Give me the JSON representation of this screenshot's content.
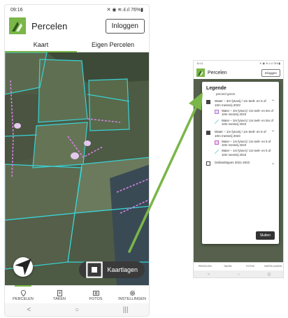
{
  "status_bar": {
    "time": "09:16",
    "icons": "✕ ◉ ≋.ıl.ıl 76%▮"
  },
  "app": {
    "title": "Percelen",
    "login": "Inloggen"
  },
  "tabs": [
    {
      "label": "Kaart"
    },
    {
      "label": "Eigen Percelen"
    }
  ],
  "map_controls": {
    "layers_label": "Kaartlagen"
  },
  "bottom_nav": [
    {
      "label": "PERCELEN",
      "icon": "pin-icon"
    },
    {
      "label": "TAKEN",
      "icon": "tasks-icon"
    },
    {
      "label": "FOTOS",
      "icon": "photo-icon"
    },
    {
      "label": "INSTELLINGEN",
      "icon": "gear-icon"
    }
  ],
  "system_nav": {
    "back": "<",
    "home": "○",
    "recents": "|||"
  },
  "zoomed": {
    "status_time": "10:11",
    "app_title": "Percelen",
    "login": "Inloggen",
    "legend": {
      "title": "Legende",
      "first_item": "perceel grens",
      "groups": [
        {
          "label": "Water – 3m fytovrij / 1m teelt- en 5 of 10m mestvrij 2023",
          "checked": true,
          "subs": [
            {
              "label": "Water – 3m fytovrij / 1m teelt- en 5m of 10m mestvrij 2023",
              "color": "#c9b0e0"
            },
            {
              "label": "Water – 3m fytovrij / 1m teelt- en 5m of 10m mestvrij 2023",
              "color": "#8ad0c8"
            }
          ]
        },
        {
          "label": "Water – 1m fytovrij / 1m teelt- en 5 of 10m mestvrij 2023",
          "checked": true,
          "subs": [
            {
              "label": "Water – 1m fytovrij / 1m teelt- en 5 of 10m mestvrij 2023",
              "color": "#d9a0d9"
            },
            {
              "label": "Water – 1m fytovrij / 1m teelt- en 5 of 10m mestvrij 2023",
              "color": "#9adad0"
            }
          ]
        },
        {
          "label": "Gebiedstypes 2021-2022",
          "checked": false,
          "subs": []
        }
      ],
      "close": "Sluiten"
    },
    "bottom_nav": [
      "PERCELEN",
      "TAKEN",
      "FOTOS",
      "INSTELLINGEN"
    ]
  },
  "colors": {
    "accent": "#7ab648",
    "parcel_line": "#39d3d6",
    "water_line": "#d480e0"
  }
}
